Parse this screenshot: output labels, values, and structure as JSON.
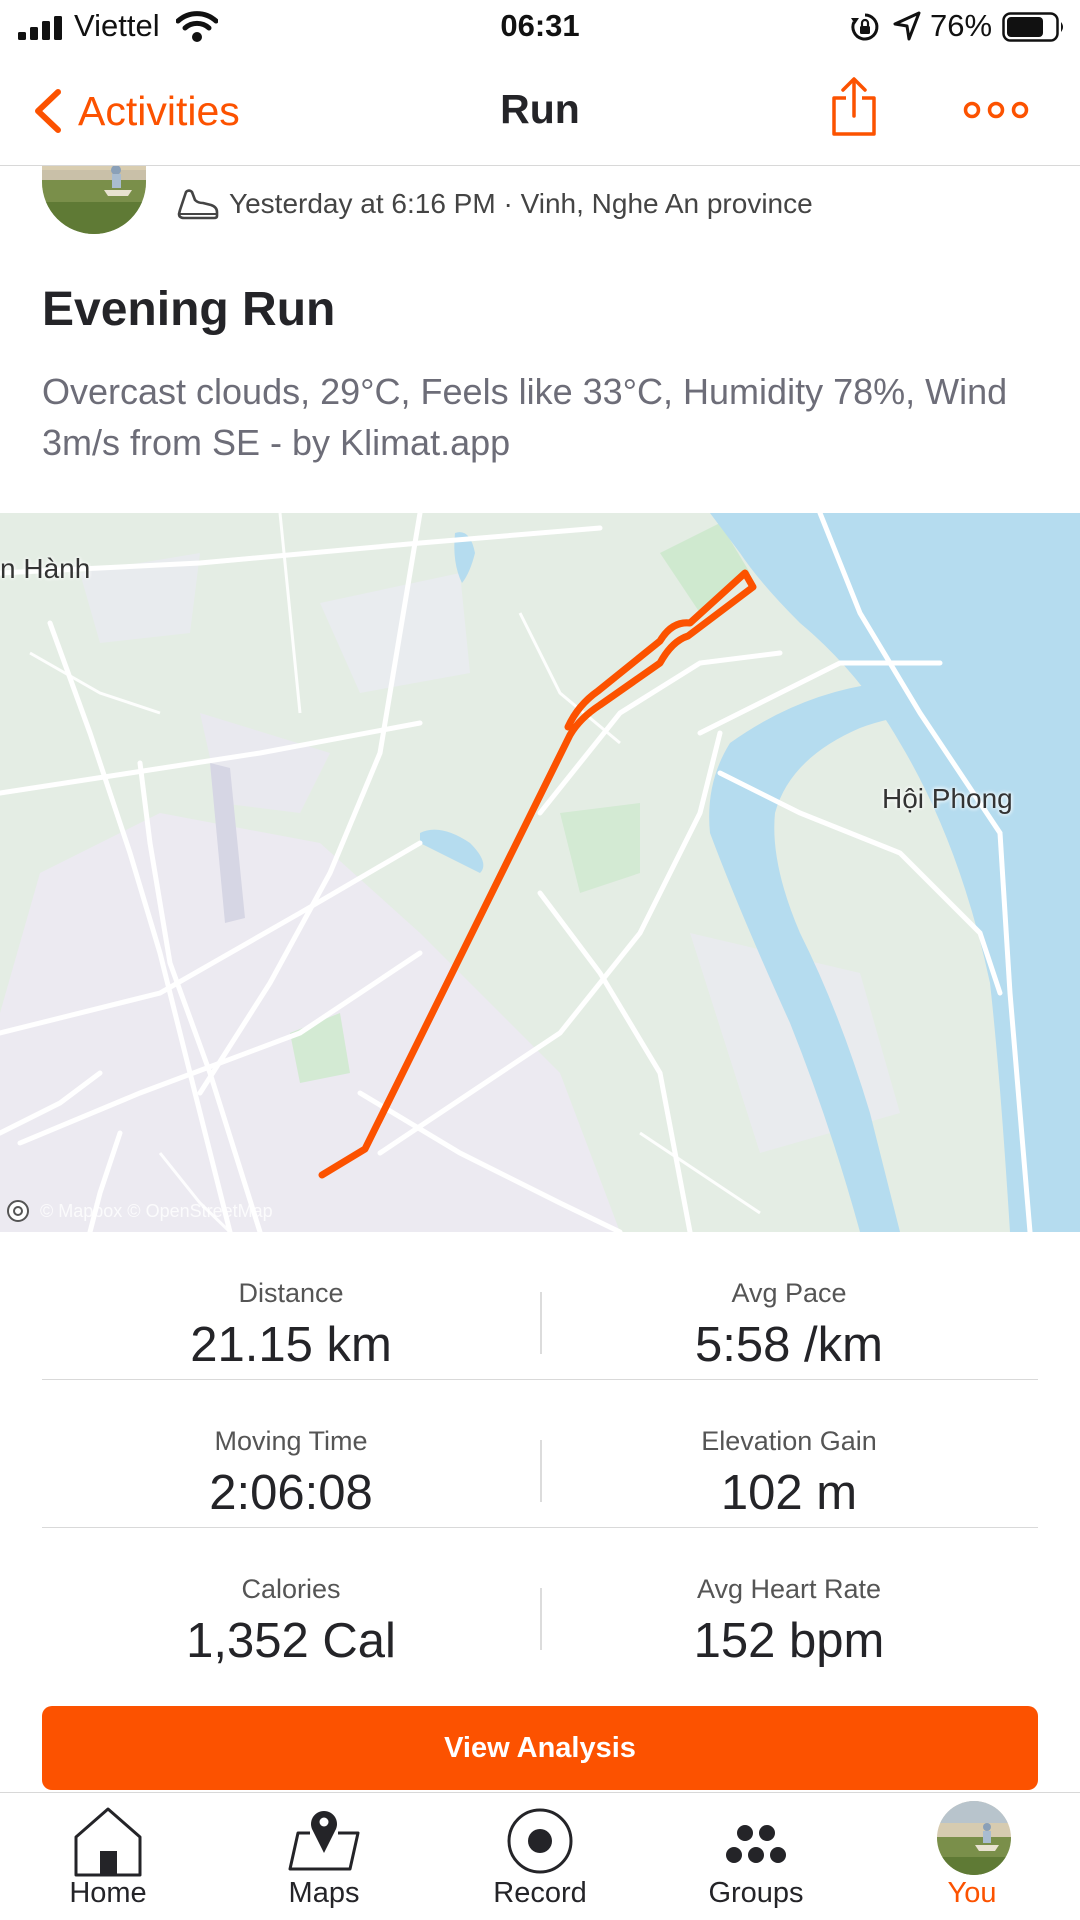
{
  "status_bar": {
    "carrier": "Viettel",
    "time": "06:31",
    "battery_percent": "76%",
    "battery_level": 0.76,
    "icons": [
      "signal-bars-icon",
      "wifi-icon",
      "orientation-lock-icon",
      "location-arrow-icon",
      "battery-icon"
    ]
  },
  "nav": {
    "back_label": "Activities",
    "title": "Run",
    "share_icon": "share-icon",
    "more_icon": "more-dots-icon"
  },
  "colors": {
    "accent": "#fc5200",
    "text_primary": "#242428",
    "text_secondary": "#6d6d78",
    "water": "#b5dcef",
    "park": "#cfe9cf"
  },
  "activity": {
    "meta": "Yesterday at 6:16 PM · Vinh, Nghe An province",
    "title": "Evening Run",
    "description": "Overcast clouds, 29°C, Feels like 33°C, Humidity 78%, Wind 3m/s from SE - by Klimat.app",
    "sport_icon": "shoe-icon"
  },
  "map": {
    "labels": {
      "hanh": "n Hành",
      "hoi_phong": "Hội Phong"
    },
    "attribution": "© Mapbox © OpenStreetMap"
  },
  "stats": [
    {
      "left": {
        "label": "Distance",
        "value": "21.15 km"
      },
      "right": {
        "label": "Avg Pace",
        "value": "5:58 /km"
      }
    },
    {
      "left": {
        "label": "Moving Time",
        "value": "2:06:08"
      },
      "right": {
        "label": "Elevation Gain",
        "value": "102 m"
      }
    },
    {
      "left": {
        "label": "Calories",
        "value": "1,352 Cal"
      },
      "right": {
        "label": "Avg Heart Rate",
        "value": "152 bpm"
      }
    }
  ],
  "cta": {
    "label": "View Analysis"
  },
  "tabs": [
    {
      "label": "Home",
      "icon": "home-icon"
    },
    {
      "label": "Maps",
      "icon": "map-pin-icon"
    },
    {
      "label": "Record",
      "icon": "record-icon"
    },
    {
      "label": "Groups",
      "icon": "groups-icon"
    },
    {
      "label": "You",
      "icon": "avatar",
      "active": true
    }
  ]
}
